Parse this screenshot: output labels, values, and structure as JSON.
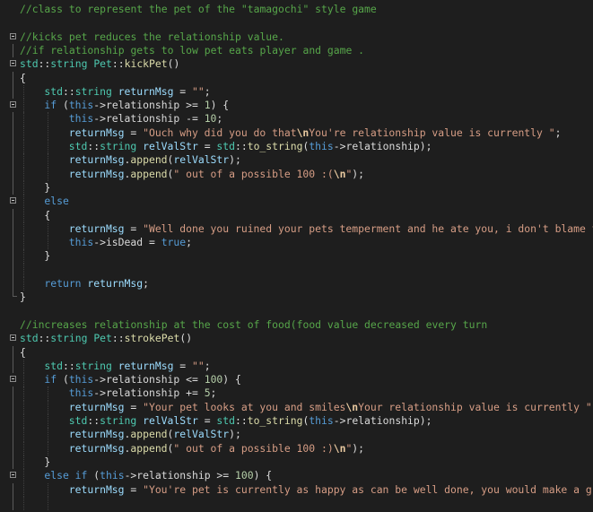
{
  "editor": {
    "colors": {
      "background": "#1e1e1e",
      "comment": "#57a64a",
      "keyword": "#569cd6",
      "class": "#4ec9b0",
      "function": "#dcdcaa",
      "string": "#d69d85",
      "escape": "#e8c9a0",
      "member": "#dadada",
      "local": "#9cdcfe",
      "number": "#b5cea8",
      "plain": "#dcdcdc"
    },
    "lines": [
      {
        "indent": 0,
        "marker": "none",
        "tokens": [
          [
            "comment",
            "//class to represent the pet of the \"tamagochi\" style game"
          ]
        ]
      },
      {
        "indent": 0,
        "marker": "none",
        "tokens": []
      },
      {
        "indent": 0,
        "marker": "fold",
        "tokens": [
          [
            "comment",
            "//kicks pet reduces the relationship value."
          ]
        ]
      },
      {
        "indent": 0,
        "marker": "vline",
        "tokens": [
          [
            "comment",
            "//if relationship gets to low pet eats player and game ."
          ]
        ]
      },
      {
        "indent": 0,
        "marker": "fold",
        "tokens": [
          [
            "class",
            "std"
          ],
          [
            "plain",
            "::"
          ],
          [
            "class",
            "string"
          ],
          [
            "plain",
            " "
          ],
          [
            "class",
            "Pet"
          ],
          [
            "plain",
            "::"
          ],
          [
            "func",
            "kickPet"
          ],
          [
            "plain",
            "()"
          ]
        ]
      },
      {
        "indent": 0,
        "marker": "vline",
        "tokens": [
          [
            "plain",
            "{"
          ]
        ]
      },
      {
        "indent": 1,
        "marker": "vline",
        "tokens": [
          [
            "class",
            "std"
          ],
          [
            "plain",
            "::"
          ],
          [
            "class",
            "string"
          ],
          [
            "plain",
            " "
          ],
          [
            "local",
            "returnMsg"
          ],
          [
            "plain",
            " = "
          ],
          [
            "string",
            "\"\""
          ],
          [
            "plain",
            ";"
          ]
        ]
      },
      {
        "indent": 1,
        "marker": "fold",
        "tokens": [
          [
            "keyword",
            "if"
          ],
          [
            "plain",
            " ("
          ],
          [
            "keyword",
            "this"
          ],
          [
            "plain",
            "->"
          ],
          [
            "member",
            "relationship"
          ],
          [
            "plain",
            " >= "
          ],
          [
            "number",
            "1"
          ],
          [
            "plain",
            ") {"
          ]
        ]
      },
      {
        "indent": 2,
        "marker": "vline",
        "tokens": [
          [
            "keyword",
            "this"
          ],
          [
            "plain",
            "->"
          ],
          [
            "member",
            "relationship"
          ],
          [
            "plain",
            " -= "
          ],
          [
            "number",
            "10"
          ],
          [
            "plain",
            ";"
          ]
        ]
      },
      {
        "indent": 2,
        "marker": "vline",
        "tokens": [
          [
            "local",
            "returnMsg"
          ],
          [
            "plain",
            " = "
          ],
          [
            "string",
            "\"Ouch why did you do that"
          ],
          [
            "escape",
            "\\n"
          ],
          [
            "string",
            "You're relationship value is currently \""
          ],
          [
            "plain",
            ";"
          ]
        ]
      },
      {
        "indent": 2,
        "marker": "vline",
        "tokens": [
          [
            "class",
            "std"
          ],
          [
            "plain",
            "::"
          ],
          [
            "class",
            "string"
          ],
          [
            "plain",
            " "
          ],
          [
            "local",
            "relValStr"
          ],
          [
            "plain",
            " = "
          ],
          [
            "class",
            "std"
          ],
          [
            "plain",
            "::"
          ],
          [
            "func",
            "to_string"
          ],
          [
            "plain",
            "("
          ],
          [
            "keyword",
            "this"
          ],
          [
            "plain",
            "->"
          ],
          [
            "member",
            "relationship"
          ],
          [
            "plain",
            ");"
          ]
        ]
      },
      {
        "indent": 2,
        "marker": "vline",
        "tokens": [
          [
            "local",
            "returnMsg"
          ],
          [
            "plain",
            "."
          ],
          [
            "func",
            "append"
          ],
          [
            "plain",
            "("
          ],
          [
            "local",
            "relValStr"
          ],
          [
            "plain",
            ");"
          ]
        ]
      },
      {
        "indent": 2,
        "marker": "vline",
        "tokens": [
          [
            "local",
            "returnMsg"
          ],
          [
            "plain",
            "."
          ],
          [
            "func",
            "append"
          ],
          [
            "plain",
            "("
          ],
          [
            "string",
            "\" out of a possible 100 :("
          ],
          [
            "escape",
            "\\n"
          ],
          [
            "string",
            "\""
          ],
          [
            "plain",
            ");"
          ]
        ]
      },
      {
        "indent": 1,
        "marker": "vline",
        "tokens": [
          [
            "plain",
            "}"
          ]
        ]
      },
      {
        "indent": 1,
        "marker": "fold",
        "tokens": [
          [
            "keyword",
            "else"
          ]
        ]
      },
      {
        "indent": 1,
        "marker": "vline",
        "tokens": [
          [
            "plain",
            "{"
          ]
        ]
      },
      {
        "indent": 2,
        "marker": "vline",
        "tokens": [
          [
            "local",
            "returnMsg"
          ],
          [
            "plain",
            " = "
          ],
          [
            "string",
            "\"Well done you ruined your pets temperment and he ate you, i don't blame t"
          ]
        ]
      },
      {
        "indent": 2,
        "marker": "vline",
        "tokens": [
          [
            "keyword",
            "this"
          ],
          [
            "plain",
            "->"
          ],
          [
            "member",
            "isDead"
          ],
          [
            "plain",
            " = "
          ],
          [
            "keyword",
            "true"
          ],
          [
            "plain",
            ";"
          ]
        ]
      },
      {
        "indent": 1,
        "marker": "vline",
        "tokens": [
          [
            "plain",
            "}"
          ]
        ]
      },
      {
        "indent": 1,
        "marker": "vline",
        "tokens": []
      },
      {
        "indent": 1,
        "marker": "vline",
        "tokens": [
          [
            "keyword",
            "return"
          ],
          [
            "plain",
            " "
          ],
          [
            "local",
            "returnMsg"
          ],
          [
            "plain",
            ";"
          ]
        ]
      },
      {
        "indent": 0,
        "marker": "end",
        "tokens": [
          [
            "plain",
            "}"
          ]
        ]
      },
      {
        "indent": 0,
        "marker": "none",
        "tokens": []
      },
      {
        "indent": 0,
        "marker": "none",
        "tokens": [
          [
            "comment",
            "//increases relationship at the cost of food(food value decreased every turn"
          ]
        ]
      },
      {
        "indent": 0,
        "marker": "fold",
        "tokens": [
          [
            "class",
            "std"
          ],
          [
            "plain",
            "::"
          ],
          [
            "class",
            "string"
          ],
          [
            "plain",
            " "
          ],
          [
            "class",
            "Pet"
          ],
          [
            "plain",
            "::"
          ],
          [
            "func",
            "strokePet"
          ],
          [
            "plain",
            "()"
          ]
        ]
      },
      {
        "indent": 0,
        "marker": "vline",
        "tokens": [
          [
            "plain",
            "{"
          ]
        ]
      },
      {
        "indent": 1,
        "marker": "vline",
        "tokens": [
          [
            "class",
            "std"
          ],
          [
            "plain",
            "::"
          ],
          [
            "class",
            "string"
          ],
          [
            "plain",
            " "
          ],
          [
            "local",
            "returnMsg"
          ],
          [
            "plain",
            " = "
          ],
          [
            "string",
            "\"\""
          ],
          [
            "plain",
            ";"
          ]
        ]
      },
      {
        "indent": 1,
        "marker": "fold",
        "tokens": [
          [
            "keyword",
            "if"
          ],
          [
            "plain",
            " ("
          ],
          [
            "keyword",
            "this"
          ],
          [
            "plain",
            "->"
          ],
          [
            "member",
            "relationship"
          ],
          [
            "plain",
            " <= "
          ],
          [
            "number",
            "100"
          ],
          [
            "plain",
            ") {"
          ]
        ]
      },
      {
        "indent": 2,
        "marker": "vline",
        "tokens": [
          [
            "keyword",
            "this"
          ],
          [
            "plain",
            "->"
          ],
          [
            "member",
            "relationship"
          ],
          [
            "plain",
            " += "
          ],
          [
            "number",
            "5"
          ],
          [
            "plain",
            ";"
          ]
        ]
      },
      {
        "indent": 2,
        "marker": "vline",
        "tokens": [
          [
            "local",
            "returnMsg"
          ],
          [
            "plain",
            " = "
          ],
          [
            "string",
            "\"Your pet looks at you and smiles"
          ],
          [
            "escape",
            "\\n"
          ],
          [
            "string",
            "Your relationship value is currently \""
          ]
        ]
      },
      {
        "indent": 2,
        "marker": "vline",
        "tokens": [
          [
            "class",
            "std"
          ],
          [
            "plain",
            "::"
          ],
          [
            "class",
            "string"
          ],
          [
            "plain",
            " "
          ],
          [
            "local",
            "relValStr"
          ],
          [
            "plain",
            " = "
          ],
          [
            "class",
            "std"
          ],
          [
            "plain",
            "::"
          ],
          [
            "func",
            "to_string"
          ],
          [
            "plain",
            "("
          ],
          [
            "keyword",
            "this"
          ],
          [
            "plain",
            "->"
          ],
          [
            "member",
            "relationship"
          ],
          [
            "plain",
            ");"
          ]
        ]
      },
      {
        "indent": 2,
        "marker": "vline",
        "tokens": [
          [
            "local",
            "returnMsg"
          ],
          [
            "plain",
            "."
          ],
          [
            "func",
            "append"
          ],
          [
            "plain",
            "("
          ],
          [
            "local",
            "relValStr"
          ],
          [
            "plain",
            ");"
          ]
        ]
      },
      {
        "indent": 2,
        "marker": "vline",
        "tokens": [
          [
            "local",
            "returnMsg"
          ],
          [
            "plain",
            "."
          ],
          [
            "func",
            "append"
          ],
          [
            "plain",
            "("
          ],
          [
            "string",
            "\" out of a possible 100 :)"
          ],
          [
            "escape",
            "\\n"
          ],
          [
            "string",
            "\""
          ],
          [
            "plain",
            ");"
          ]
        ]
      },
      {
        "indent": 1,
        "marker": "vline",
        "tokens": [
          [
            "plain",
            "}"
          ]
        ]
      },
      {
        "indent": 1,
        "marker": "fold",
        "tokens": [
          [
            "keyword",
            "else if"
          ],
          [
            "plain",
            " ("
          ],
          [
            "keyword",
            "this"
          ],
          [
            "plain",
            "->"
          ],
          [
            "member",
            "relationship"
          ],
          [
            "plain",
            " >= "
          ],
          [
            "number",
            "100"
          ],
          [
            "plain",
            ") {"
          ]
        ]
      },
      {
        "indent": 2,
        "marker": "vline",
        "tokens": [
          [
            "local",
            "returnMsg"
          ],
          [
            "plain",
            " = "
          ],
          [
            "string",
            "\"You're pet is currently as happy as can be well done, you would make a g"
          ]
        ]
      },
      {
        "indent": 2,
        "marker": "vline",
        "tokens": []
      }
    ]
  }
}
